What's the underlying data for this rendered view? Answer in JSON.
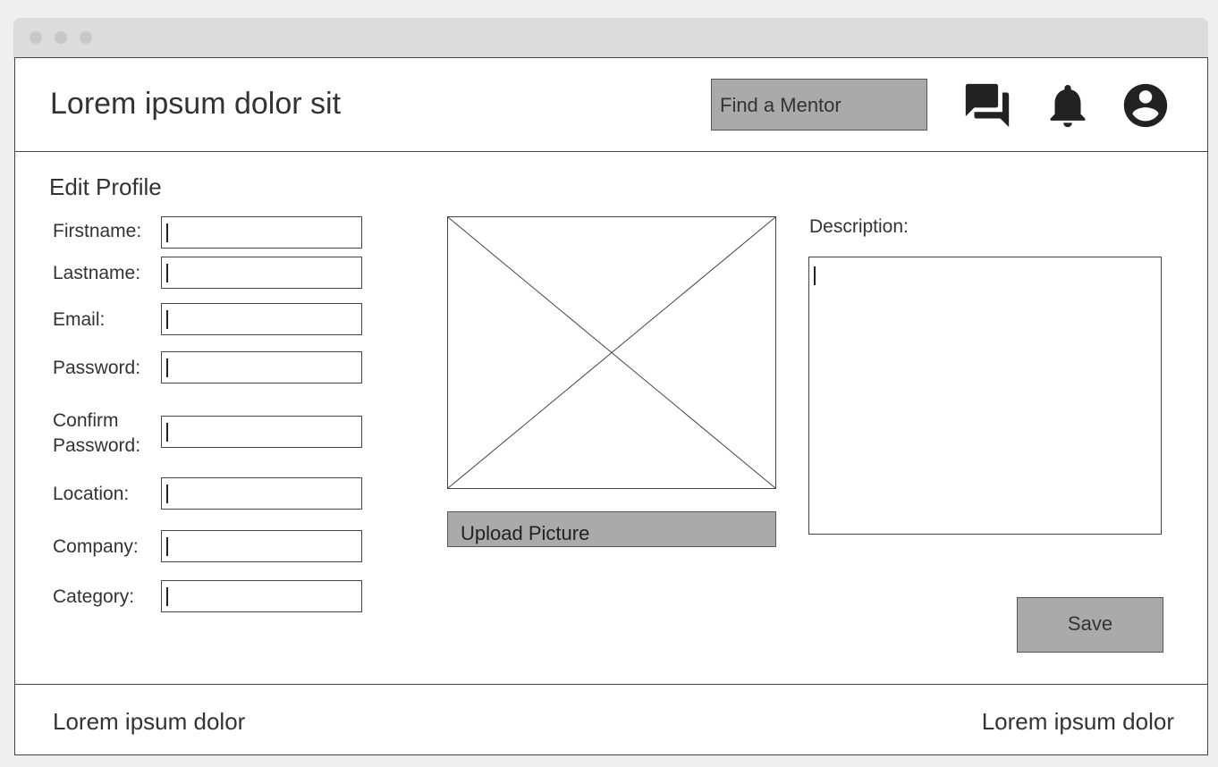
{
  "header": {
    "app_title": "Lorem ipsum dolor sit",
    "search_label": "Find a Mentor",
    "icons": [
      "forum-icon",
      "bell-icon",
      "account-icon"
    ]
  },
  "page": {
    "title": "Edit Profile"
  },
  "form": {
    "fields": [
      {
        "label": "Firstname:",
        "value": ""
      },
      {
        "label": "Lastname:",
        "value": ""
      },
      {
        "label": "Email:",
        "value": ""
      },
      {
        "label": "Password:",
        "value": ""
      },
      {
        "label_line1": "Confirm",
        "label_line2": "Password:",
        "value": ""
      },
      {
        "label": "Location:",
        "value": ""
      },
      {
        "label": "Company:",
        "value": ""
      },
      {
        "label": "Category:",
        "value": ""
      }
    ],
    "upload_label": "Upload Picture",
    "description_label": "Description:",
    "description_value": "",
    "save_label": "Save"
  },
  "footer": {
    "left": "Lorem ipsum dolor",
    "right": "Lorem ipsum dolor"
  },
  "colors": {
    "button_gray": "#aaaaaa",
    "border": "#444444",
    "text": "#333333"
  }
}
